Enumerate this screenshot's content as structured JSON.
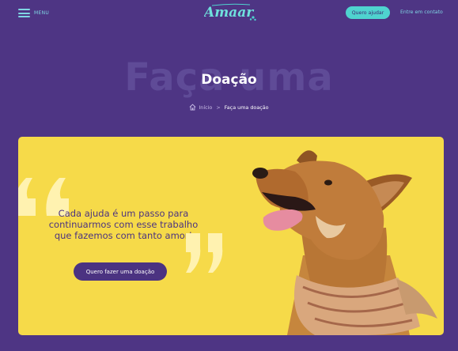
{
  "header": {
    "menu_label": "MENU",
    "logo_text": "Amaar",
    "cta_label": "Quero ajudar",
    "contact_label": "Entre em contato"
  },
  "hero": {
    "background_text": "Faça uma",
    "title": "Doação",
    "breadcrumb": {
      "home": "Início",
      "separator": ">",
      "current": "Faça uma doação"
    }
  },
  "banner": {
    "line1": "Cada ajuda é um passo para",
    "line2": "continuarmos com esse trabalho",
    "line3": "que fazemos com tanto amor!",
    "button_label": "Quero fazer uma doação"
  },
  "colors": {
    "background": "#4e3584",
    "accent": "#4fd3cf",
    "banner": "#f6da49",
    "text_dark": "#4b3381"
  },
  "icons": {
    "menu": "hamburger-icon",
    "home": "home-icon",
    "quote_open": "quote-open-icon",
    "quote_close": "quote-close-icon"
  }
}
